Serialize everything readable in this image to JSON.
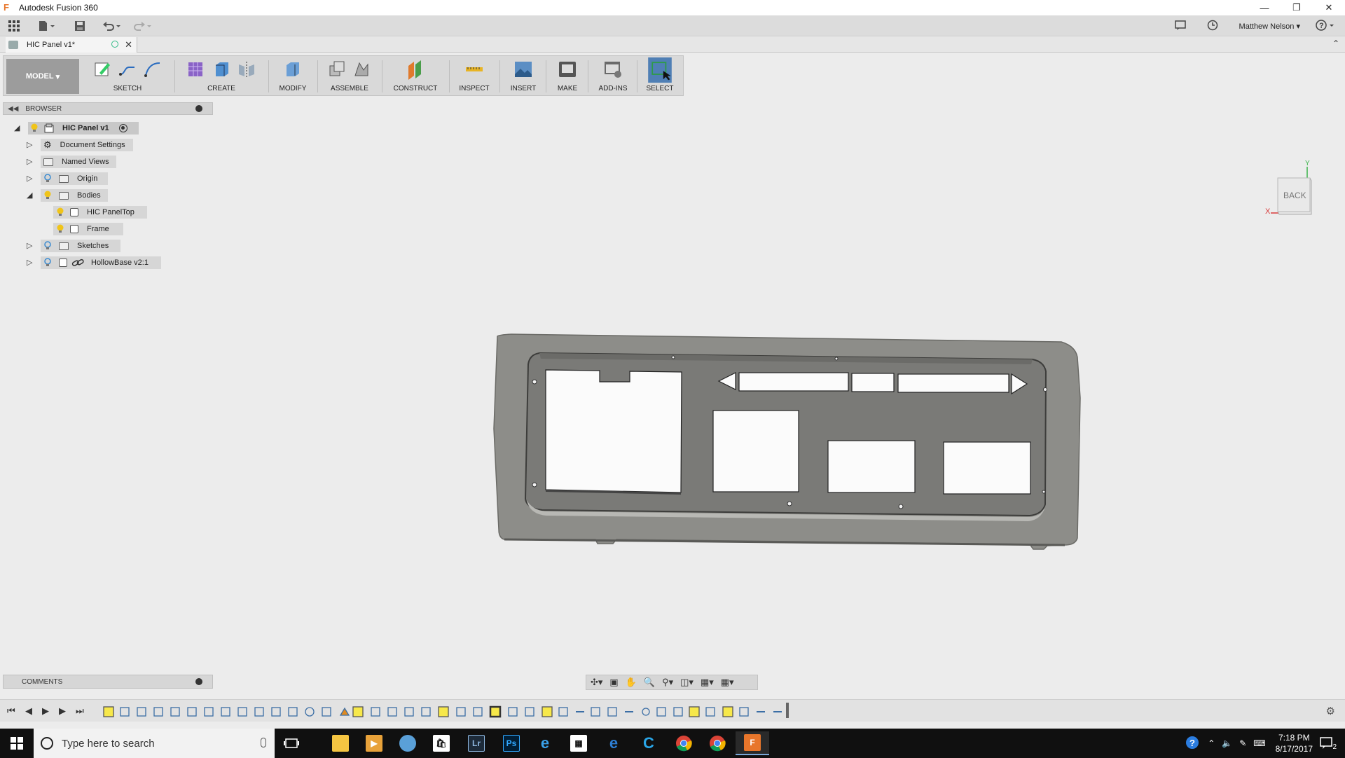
{
  "window": {
    "title": "Autodesk Fusion 360"
  },
  "quick_access": {
    "user_name": "Matthew Nelson"
  },
  "document_tab": {
    "name": "HIC Panel v1*"
  },
  "ribbon": {
    "workspace": "MODEL",
    "groups": [
      "SKETCH",
      "CREATE",
      "MODIFY",
      "ASSEMBLE",
      "CONSTRUCT",
      "INSPECT",
      "INSERT",
      "MAKE",
      "ADD-INS",
      "SELECT"
    ],
    "accent_color": "#4f7fb5"
  },
  "browser": {
    "title": "BROWSER",
    "root": "HIC Panel v1",
    "items": [
      {
        "label": "Document Settings"
      },
      {
        "label": "Named Views"
      },
      {
        "label": "Origin"
      },
      {
        "label": "Bodies"
      },
      {
        "label": "HIC PanelTop"
      },
      {
        "label": "Frame"
      },
      {
        "label": "Sketches"
      },
      {
        "label": "HollowBase v2:1"
      }
    ]
  },
  "viewcube": {
    "face_label": "BACK",
    "axis_x": "X",
    "axis_y": "Y"
  },
  "comments": {
    "title": "COMMENTS"
  },
  "taskbar": {
    "search_placeholder": "Type here to search",
    "time": "7:18 PM",
    "date": "8/17/2017",
    "notification_count": "2"
  }
}
